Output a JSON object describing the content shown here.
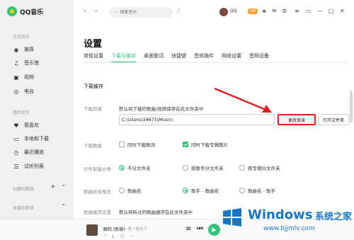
{
  "app": {
    "name": "QQ音乐",
    "brand_color": "#31c27c",
    "accent_color": "#ffcd00"
  },
  "sidebar": {
    "sections": [
      {
        "title": "在线音乐",
        "items": [
          {
            "label": "推荐",
            "icon": "disc-icon"
          },
          {
            "label": "音乐馆",
            "icon": "music-note-icon"
          },
          {
            "label": "视频",
            "icon": "video-icon"
          },
          {
            "label": "电台",
            "icon": "radio-icon"
          }
        ]
      },
      {
        "title": "我的音乐",
        "items": [
          {
            "label": "我喜欢",
            "icon": "heart-icon"
          },
          {
            "label": "本地和下载",
            "icon": "computer-icon"
          },
          {
            "label": "最近播放",
            "icon": "clock-icon"
          },
          {
            "label": "试听列表",
            "icon": "list-icon"
          }
        ]
      }
    ],
    "created_playlists": "创建的歌单",
    "collected_playlists": "收藏的歌单",
    "add_symbol": "+",
    "expand_symbol": "⌄"
  },
  "topbar": {
    "search_placeholder": "搜索音乐",
    "username": "QQ",
    "badge": "VIP"
  },
  "settings": {
    "title": "设置",
    "tabs": [
      "常规设置",
      "下载与缓存",
      "桌面歌词",
      "快捷键",
      "音效插件",
      "网络设置",
      "音频设备"
    ],
    "active_tab": 1,
    "section_title": "下载缓存",
    "download_dir": {
      "label": "下载目录",
      "description": "默认将下载的歌曲/视频保存在此文件夹中",
      "path": "C:\\Users\\34675\\Music\\",
      "change_button": "更改目录",
      "open_button": "打开文件夹"
    },
    "download_songs": {
      "label": "下载歌曲",
      "options": [
        {
          "label": "同时下载歌词",
          "checked": false
        },
        {
          "label": "同时下载专辑图片",
          "checked": true
        }
      ]
    },
    "smart_folder": {
      "label": "文件智能分类",
      "options": [
        {
          "label": "不分文件夹",
          "selected": true
        },
        {
          "label": "按歌手分文件夹",
          "selected": false
        },
        {
          "label": "按专辑分文件夹",
          "selected": false
        }
      ]
    },
    "naming": {
      "label": "歌曲命名格式",
      "options": [
        {
          "label": "歌曲名",
          "selected": false
        },
        {
          "label": "歌手 - 歌曲名",
          "selected": true
        },
        {
          "label": "歌曲名 - 歌手",
          "selected": false
        }
      ]
    },
    "cache": {
      "label": "歌曲缓存设置",
      "description": "默认将听过的歌曲缓存在此文件夹中"
    }
  },
  "player": {
    "song": "解药 (新版)",
    "artist": "—我一姐在下",
    "extra_icons": [
      "heart-icon",
      "download-icon",
      "comment-icon",
      "more-icon"
    ]
  },
  "watermark": {
    "title": "Windows",
    "cn": "系统之家",
    "url": "www.bjjmlv.com"
  }
}
